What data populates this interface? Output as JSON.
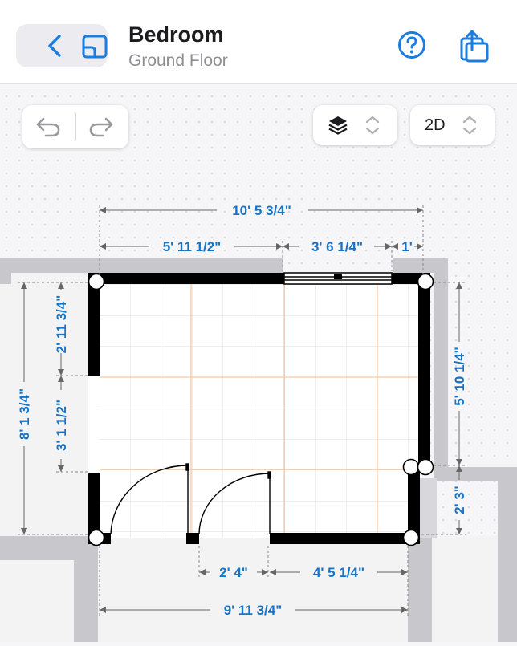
{
  "header": {
    "title": "Bedroom",
    "subtitle": "Ground Floor",
    "icons": {
      "back": "chevron-left-icon",
      "floorplan": "floorplan-icon",
      "help": "help-circle-icon",
      "share": "share-icon"
    }
  },
  "toolbar": {
    "undo_icon": "undo-icon",
    "redo_icon": "redo-icon",
    "layers_icon": "layers-icon",
    "view_mode": "2D"
  },
  "dimensions": {
    "top_total": "10' 5 3/4\"",
    "top_left": "5' 11 1/2\"",
    "top_window": "3' 6 1/4\"",
    "top_right": "1'",
    "left_total": "8' 1 3/4\"",
    "left_upper": "2' 11 3/4\"",
    "left_opening": "3' 1 1/2\"",
    "right_upper": "5' 10 1/4\"",
    "right_lower": "2' 3\"",
    "bottom_door": "2' 4\"",
    "bottom_wall": "4' 5 1/4\"",
    "bottom_total": "9' 11 3/4\""
  },
  "colors": {
    "accent": "#1673c5",
    "wall": "#000000",
    "outer_wall": "#c8c8cc",
    "tile_grid": "#e0e0e0",
    "guide": "#f2c9a8"
  }
}
